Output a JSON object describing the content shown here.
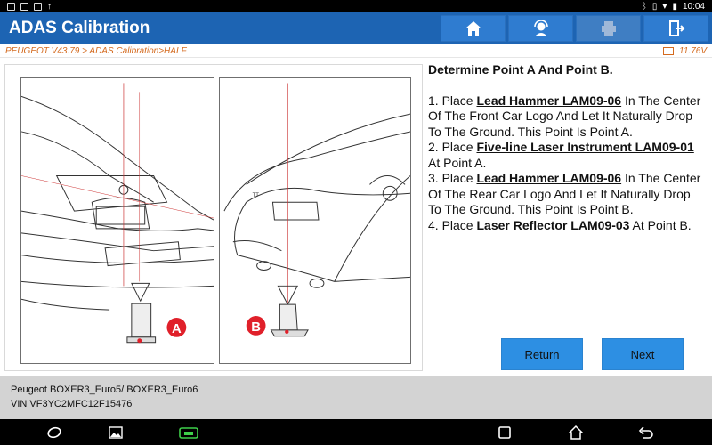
{
  "status_bar": {
    "time": "10:04"
  },
  "app": {
    "title": "ADAS Calibration"
  },
  "header_buttons": {
    "home": "home-icon",
    "service": "support-agent-icon",
    "print": "printer-icon",
    "exit": "exit-icon"
  },
  "breadcrumb": {
    "path": "PEUGEOT V43.79 > ADAS Calibration>HALF",
    "voltage": "11.76V"
  },
  "figure": {
    "label_a": "A",
    "label_b": "B",
    "rear_badge": "ТТ"
  },
  "instructions": {
    "heading": "Determine Point A And Point B.",
    "s1_pre": "1. Place ",
    "s1_tool": "Lead Hammer LAM09-06",
    "s1_post": " In The Center Of The Front Car Logo And Let It Naturally Drop To The Ground. This Point Is Point A.",
    "s2_pre": "2. Place ",
    "s2_tool": "Five-line Laser Instrument LAM09-01",
    "s2_post": " At Point A.",
    "s3_pre": "3. Place ",
    "s3_tool": "Lead Hammer LAM09-06",
    "s3_post": " In The Center Of The Rear Car Logo And Let It Naturally Drop To The Ground. This Point Is Point B.",
    "s4_pre": "4. Place ",
    "s4_tool": "Laser Reflector LAM09-03",
    "s4_post": " At Point B."
  },
  "buttons": {
    "return": "Return",
    "next": "Next"
  },
  "vehicle": {
    "model": "Peugeot BOXER3_Euro5/ BOXER3_Euro6",
    "vin": "VIN VF3YC2MFC12F15476"
  },
  "colors": {
    "header": "#1d64b3",
    "button": "#2d8fe3",
    "accent": "#d46a1e",
    "marker": "#e0202a"
  }
}
